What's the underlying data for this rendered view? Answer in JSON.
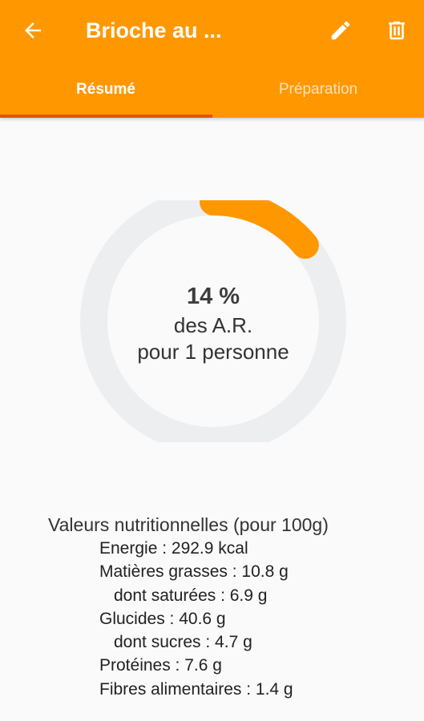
{
  "colors": {
    "primary": "#ff9800",
    "tab_indicator": "#e65100",
    "ring_track": "#eceef0",
    "ring_progress": "#ff9800",
    "background": "#fafafa"
  },
  "appbar": {
    "title": "Brioche au ...",
    "back_icon": "arrow-back-icon",
    "edit_icon": "pencil-icon",
    "delete_icon": "trash-icon"
  },
  "tabs": [
    {
      "label": "Résumé",
      "selected": true
    },
    {
      "label": "Préparation",
      "selected": false
    }
  ],
  "progress": {
    "fraction": 0.14,
    "percent_label": "14 %",
    "line1": "des A.R.",
    "line2": "pour 1 personne"
  },
  "nutrition": {
    "title": "Valeurs nutritionnelles (pour 100g)",
    "lines": [
      "Energie : 292.9 kcal",
      "Matières grasses : 10.8 g",
      "dont saturées : 6.9 g",
      "Glucides : 40.6 g",
      "dont sucres : 4.7 g",
      "Protéines : 7.6 g",
      "Fibres alimentaires : 1.4 g"
    ]
  }
}
